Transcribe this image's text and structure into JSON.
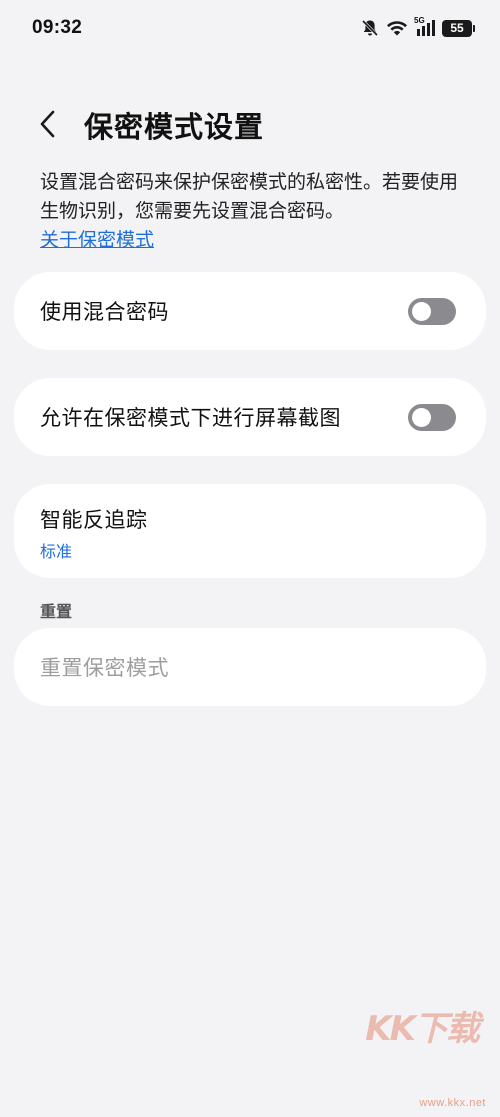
{
  "status_bar": {
    "time": "09:32",
    "network_label": "5G",
    "battery": "55",
    "icons": [
      "bell-off-icon",
      "wifi-icon",
      "signal-icon",
      "battery-icon"
    ]
  },
  "header": {
    "title": "保密模式设置",
    "back_icon": "chevron-left-icon"
  },
  "description": {
    "text": "设置混合密码来保护保密模式的私密性。若要使用生物识别，您需要先设置混合密码。",
    "link": "关于保密模式"
  },
  "settings": [
    {
      "label": "使用混合密码",
      "toggle": false
    },
    {
      "label": "允许在保密模式下进行屏幕截图",
      "toggle": false
    },
    {
      "label": "智能反追踪",
      "sub": "标准"
    }
  ],
  "reset_section": {
    "header": "重置",
    "item": "重置保密模式"
  },
  "watermark": {
    "logo": "KK下载",
    "url": "www.kkx.net"
  },
  "colors": {
    "background": "#f3f3f5",
    "card": "#ffffff",
    "accent": "#1e6fd9",
    "toggle_off": "#8a8a8f",
    "disabled_text": "#9e9e9e"
  }
}
